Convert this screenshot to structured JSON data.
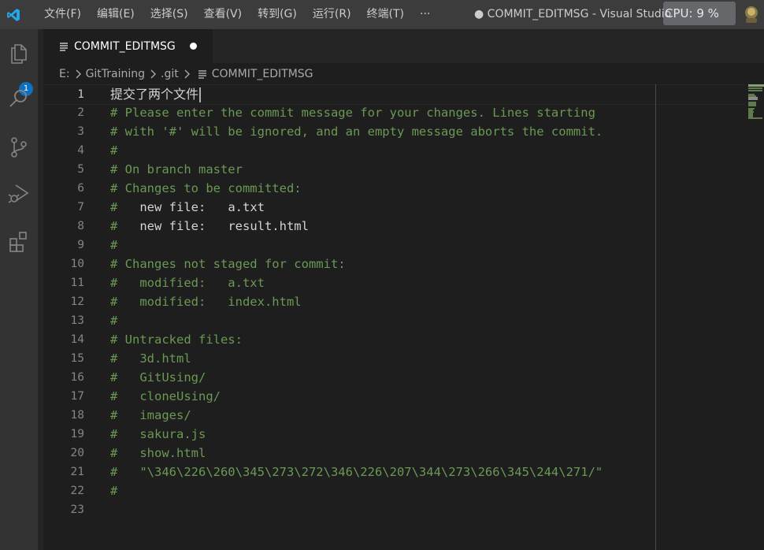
{
  "titlebar": {
    "menus": [
      "文件(F)",
      "编辑(E)",
      "选择(S)",
      "查看(V)",
      "转到(G)",
      "运行(R)",
      "终端(T)"
    ],
    "more": "···",
    "window_title": "● COMMIT_EDITMSG - Visual Studio",
    "cpu_overlay": "CPU: 9 %"
  },
  "activitybar": {
    "explorer_badge": "1"
  },
  "tab": {
    "label": "COMMIT_EDITMSG"
  },
  "breadcrumb": {
    "drive": "E:",
    "folder": "GitTraining",
    "subfolder": ".git",
    "file": "COMMIT_EDITMSG"
  },
  "editor": {
    "lines": [
      {
        "n": "1",
        "text": "提交了两个文件"
      },
      {
        "n": "2",
        "text": "# Please enter the commit message for your changes. Lines starting"
      },
      {
        "n": "3",
        "text": "# with '#' will be ignored, and an empty message aborts the commit."
      },
      {
        "n": "4",
        "text": "#"
      },
      {
        "n": "5",
        "text": "# On branch master"
      },
      {
        "n": "6",
        "text": "# Changes to be committed:"
      },
      {
        "n": "7",
        "text": "#   new file:   a.txt"
      },
      {
        "n": "8",
        "text": "#   new file:   result.html"
      },
      {
        "n": "9",
        "text": "#"
      },
      {
        "n": "10",
        "text": "# Changes not staged for commit:"
      },
      {
        "n": "11",
        "text": "#   modified:   a.txt"
      },
      {
        "n": "12",
        "text": "#   modified:   index.html"
      },
      {
        "n": "13",
        "text": "#"
      },
      {
        "n": "14",
        "text": "# Untracked files:"
      },
      {
        "n": "15",
        "text": "#   3d.html"
      },
      {
        "n": "16",
        "text": "#   GitUsing/"
      },
      {
        "n": "17",
        "text": "#   cloneUsing/"
      },
      {
        "n": "18",
        "text": "#   images/"
      },
      {
        "n": "19",
        "text": "#   sakura.js"
      },
      {
        "n": "20",
        "text": "#   show.html"
      },
      {
        "n": "21",
        "text": "#   \"\\346\\226\\260\\345\\273\\272\\346\\226\\207\\344\\273\\266\\345\\244\\271/\""
      },
      {
        "n": "22",
        "text": "#"
      },
      {
        "n": "23",
        "text": ""
      }
    ]
  },
  "colors": {
    "comment": "#6a9955",
    "accent": "#0e70c0",
    "titlebar": "#3c3c3c"
  }
}
